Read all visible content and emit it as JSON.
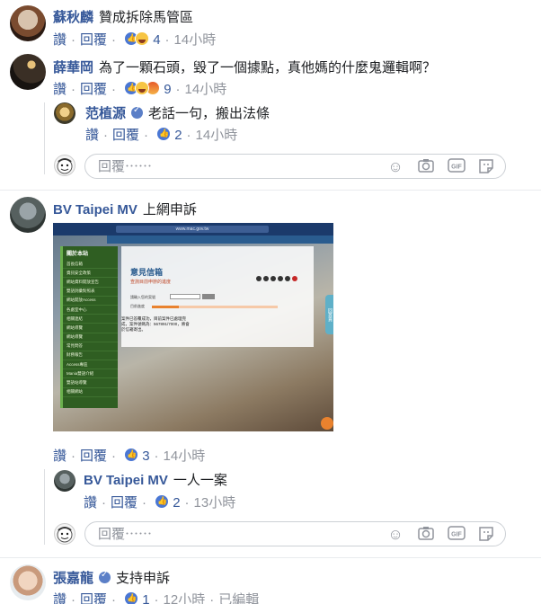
{
  "comments": [
    {
      "author": "蘇秋麟",
      "text": "贊成拆除馬管區",
      "like_label": "讚",
      "reply_label": "回覆",
      "reaction_count": "4",
      "time": "14小時"
    },
    {
      "author": "薛華岡",
      "text": "為了一顆石頭，毀了一個據點，真他媽的什麼鬼邏輯啊？",
      "like_label": "讚",
      "reply_label": "回覆",
      "reaction_count": "9",
      "time": "14小時",
      "replies": [
        {
          "author": "范植源",
          "text": "老話一句，搬出法條",
          "like_label": "讚",
          "reply_label": "回覆",
          "reaction_count": "2",
          "time": "14小時"
        }
      ],
      "reply_placeholder": "回覆⋯⋯"
    },
    {
      "author": "BV Taipei MV",
      "text": "上網申訴",
      "like_label": "讚",
      "reply_label": "回覆",
      "reaction_count": "3",
      "time": "14小時",
      "attachment": {
        "url_bar": "www.mac.gov.tw",
        "sidebar_title": "關於本站",
        "sidebar_items": [
          "首長信箱",
          "資訊安全政策",
          "網站資料開放宣告",
          "雙語詞彙對照表",
          "網站開放Access",
          "各處室中心",
          "相關連結",
          "網站導覽",
          "網站導覽",
          "常見問答",
          "財務報告",
          "Access專區",
          "Mania雙語介紹",
          "雙語站導覽",
          "相關網站"
        ],
        "heading": "意見信箱",
        "subheading": "查詢目前申辦的進度",
        "form_label_1": "請輸入您的案號",
        "form_label_2": "目前進度",
        "status_text": "案件已答覆成功，目前案件已處理完成，案件號碼為：567891/7000，將會於信箱寄出。",
        "right_tab": "回首頁"
      },
      "replies": [
        {
          "author": "BV Taipei MV",
          "text": "一人一案",
          "like_label": "讚",
          "reply_label": "回覆",
          "reaction_count": "2",
          "time": "13小時"
        }
      ],
      "reply_placeholder": "回覆⋯⋯"
    },
    {
      "author": "張嘉龍",
      "text": "支持申訴",
      "like_label": "讚",
      "reply_label": "回覆",
      "reaction_count": "1",
      "time": "12小時",
      "edited": "已編輯"
    }
  ],
  "colors": {
    "author": "#365899",
    "meta": "#90949c",
    "like_blue": "#4a77d4"
  },
  "icons": {
    "reply_box": [
      "emoji-icon",
      "camera-icon",
      "gif-icon",
      "sticker-icon"
    ]
  }
}
